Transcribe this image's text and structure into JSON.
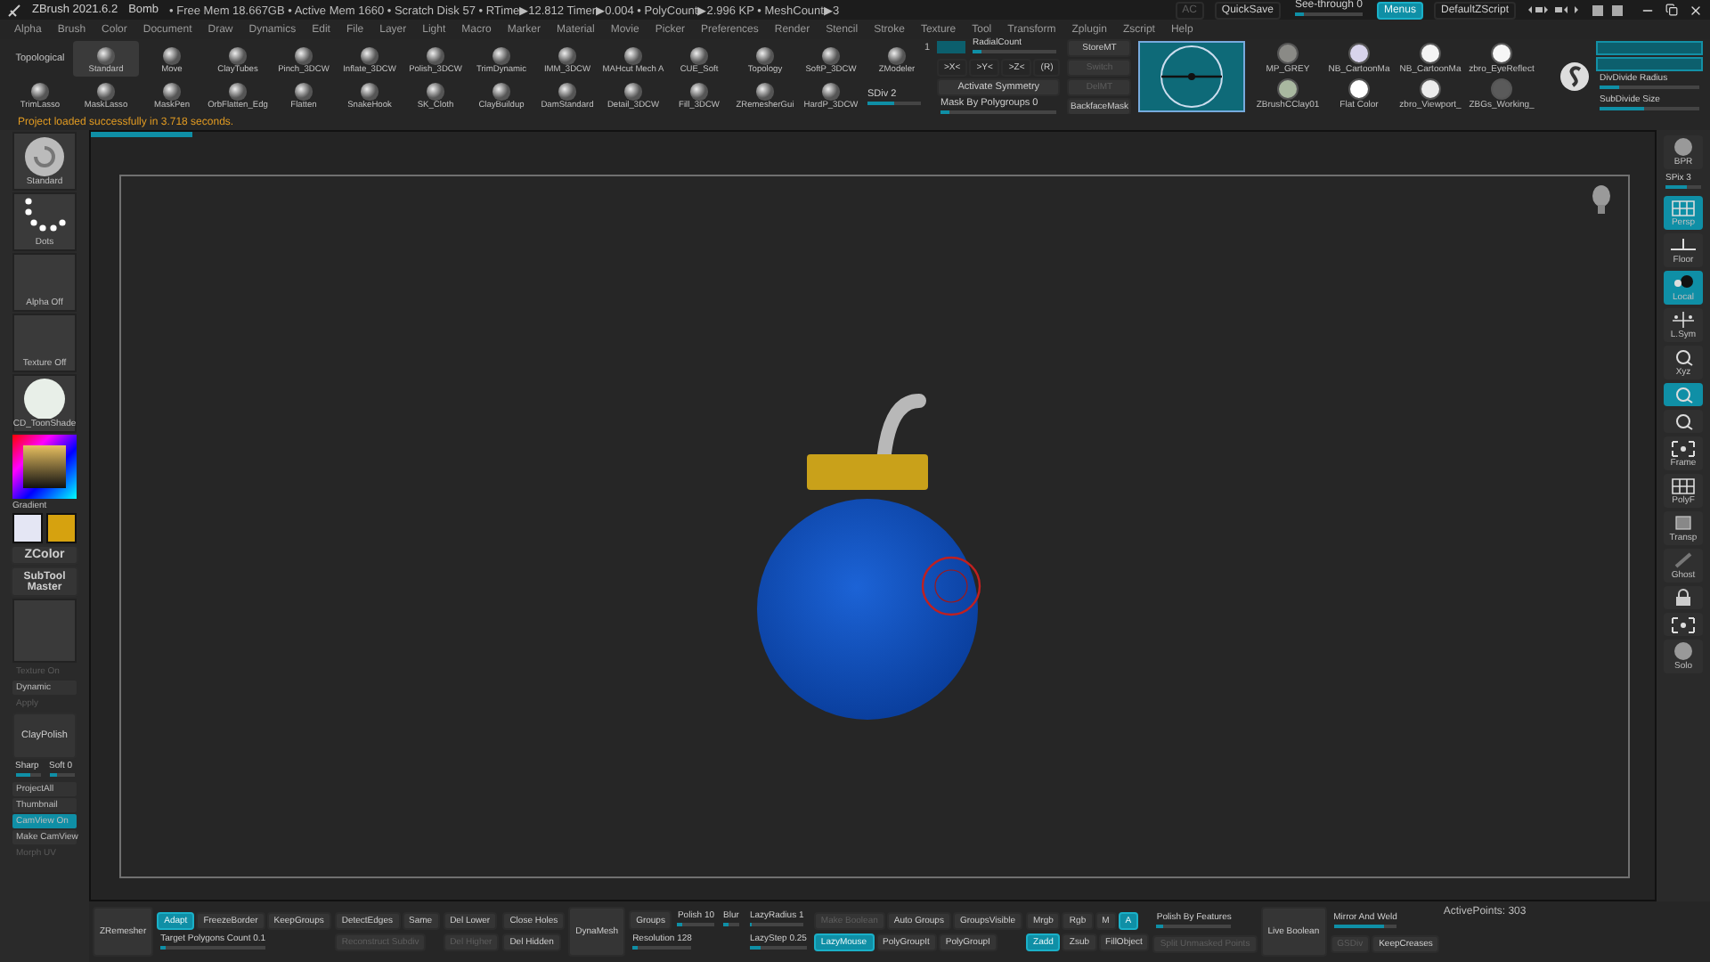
{
  "title_bar": {
    "app": "ZBrush 2021.6.2",
    "document": "Bomb",
    "status": "• Free Mem 18.667GB • Active Mem 1660 • Scratch Disk 57 • RTime▶12.812 Timer▶0.004 • PolyCount▶2.996 KP • MeshCount▶3",
    "controls": [
      {
        "kind": "button",
        "label": "AC",
        "selected": false,
        "disabled": true
      },
      {
        "kind": "button",
        "label": "QuickSave",
        "selected": false,
        "disabled": false
      },
      {
        "kind": "slider",
        "label": "See-through  0",
        "level": 0.12
      },
      {
        "kind": "button",
        "label": "Menus",
        "selected": true,
        "disabled": false
      },
      {
        "kind": "button",
        "label": "DefaultZScript",
        "selected": false,
        "disabled": false
      }
    ]
  },
  "menu": [
    "Alpha",
    "Brush",
    "Color",
    "Document",
    "Draw",
    "Dynamics",
    "Edit",
    "File",
    "Layer",
    "Light",
    "Macro",
    "Marker",
    "Material",
    "Movie",
    "Picker",
    "Preferences",
    "Render",
    "Stencil",
    "Stroke",
    "Texture",
    "Tool",
    "Transform",
    "Zplugin",
    "Zscript",
    "Help"
  ],
  "shelf": {
    "label": "Topological",
    "brush_rows": [
      [
        {
          "label": "Standard",
          "selected": true
        },
        {
          "label": "Move",
          "selected": false
        },
        {
          "label": "ClayTubes",
          "selected": false
        },
        {
          "label": "Pinch_3DCW",
          "selected": false
        },
        {
          "label": "Inflate_3DCW",
          "selected": false
        },
        {
          "label": "Polish_3DCW",
          "selected": false
        },
        {
          "label": "TrimDynamic",
          "selected": false
        },
        {
          "label": "IMM_3DCW",
          "selected": false
        },
        {
          "label": "MAHcut Mech A",
          "selected": false
        },
        {
          "label": "CUE_Soft",
          "selected": false
        },
        {
          "label": "Topology",
          "selected": false
        },
        {
          "label": "SoftP_3DCW",
          "selected": false
        },
        {
          "label": "ZModeler",
          "selected": false,
          "badge": "1"
        }
      ],
      [
        {
          "label": "TrimLasso",
          "selected": false
        },
        {
          "label": "MaskLasso",
          "selected": false
        },
        {
          "label": "MaskPen",
          "selected": false
        },
        {
          "label": "OrbFlatten_Edg",
          "selected": false
        },
        {
          "label": "Flatten",
          "selected": false
        },
        {
          "label": "SnakeHook",
          "selected": false
        },
        {
          "label": "SK_Cloth",
          "selected": false
        },
        {
          "label": "ClayBuildup",
          "selected": false
        },
        {
          "label": "DamStandard",
          "selected": false
        },
        {
          "label": "Detail_3DCW",
          "selected": false
        },
        {
          "label": "Fill_3DCW",
          "selected": false
        },
        {
          "label": "ZRemesherGui",
          "selected": false
        },
        {
          "label": "HardP_3DCW",
          "selected": false
        }
      ]
    ],
    "sdiv": {
      "label": "SDiv 2",
      "level": 0.5
    },
    "symmetry": {
      "radial_toggle": {
        "on": true
      },
      "radial": {
        "label": "RadialCount",
        "level": 0.1
      },
      "axes": [
        {
          "label": ">X<",
          "selected": false
        },
        {
          "label": ">Y<",
          "selected": false
        },
        {
          "label": ">Z<",
          "selected": false
        },
        {
          "label": "(R)",
          "selected": false
        }
      ],
      "activate": {
        "label": "Activate Symmetry",
        "selected": false
      },
      "mask": {
        "label": "Mask By Polygroups 0",
        "level": 0.08
      }
    },
    "morph": [
      {
        "label": "StoreMT",
        "disabled": false
      },
      {
        "label": "Switch",
        "disabled": true
      },
      {
        "label": "DelMT",
        "disabled": true
      },
      {
        "label": "BackfaceMask",
        "disabled": false
      }
    ],
    "materials": [
      {
        "label": "MP_GREY",
        "color": "#8a8a86"
      },
      {
        "label": "NB_CartoonMa",
        "color": "#d8d4ec"
      },
      {
        "label": "NB_CartoonMa",
        "color": "#f4f4f4"
      },
      {
        "label": "zbro_EyeReflect",
        "color": "#f6f6f6"
      },
      {
        "label": "ZBrushCClay01",
        "color": "#a9b8a0"
      },
      {
        "label": "Flat Color",
        "color": "#ffffff"
      },
      {
        "label": "zbro_Viewport_",
        "color": "#ececec"
      },
      {
        "label": "ZBGs_Working_",
        "color": "#5a5a5a"
      }
    ],
    "subdivide": [
      {
        "label": "DivDivide Radius",
        "level": 0.2
      },
      {
        "label": "SubDivide Size",
        "level": 0.45
      }
    ]
  },
  "message": "Project loaded successfully in 3.718 seconds.",
  "left_panel": [
    {
      "kind": "brush_tile",
      "label": "Standard"
    },
    {
      "kind": "dots_tile",
      "label": "Dots"
    },
    {
      "kind": "empty_tile",
      "label": "Alpha Off"
    },
    {
      "kind": "empty_tile",
      "label": "Texture Off"
    },
    {
      "kind": "material_tile",
      "label": "CD_ToonShade"
    },
    {
      "kind": "picker",
      "label": "Gradient"
    },
    {
      "kind": "swatches",
      "swatches": [
        {
          "color": "#e4e6f4"
        },
        {
          "color": "#d6a20f"
        }
      ]
    },
    {
      "kind": "zcolor",
      "label": "ZColor"
    },
    {
      "kind": "plugin",
      "label": "SubTool Master"
    },
    {
      "kind": "blank"
    },
    {
      "kind": "button",
      "label": "Texture On",
      "disabled": true,
      "selected": false
    },
    {
      "kind": "button",
      "label": "Dynamic",
      "disabled": false,
      "selected": false
    },
    {
      "kind": "button",
      "label": "Apply",
      "disabled": true,
      "selected": false
    },
    {
      "kind": "big",
      "label": "ClayPolish"
    },
    {
      "kind": "pair",
      "sliders": [
        {
          "label": "Sharp",
          "level": 0.6
        },
        {
          "label": "Soft 0",
          "level": 0.3
        }
      ]
    },
    {
      "kind": "button",
      "label": "ProjectAll",
      "disabled": false,
      "selected": false
    },
    {
      "kind": "button",
      "label": "Thumbnail",
      "disabled": false,
      "selected": false
    },
    {
      "kind": "button",
      "label": "CamView On",
      "disabled": false,
      "selected": true
    },
    {
      "kind": "button",
      "label": "Make CamView",
      "disabled": false,
      "selected": false
    },
    {
      "kind": "button",
      "label": "Morph UV",
      "disabled": true,
      "selected": false
    }
  ],
  "canvas": {
    "load_progress": {
      "level": 0.065
    }
  },
  "right_shelf": [
    {
      "kind": "tool",
      "label": "BPR",
      "selected": false
    },
    {
      "kind": "slider",
      "label": "SPix 3",
      "level": 0.6
    },
    {
      "kind": "tool",
      "label": "Persp",
      "selected": true
    },
    {
      "kind": "tool",
      "label": "Floor",
      "selected": false
    },
    {
      "kind": "tool",
      "label": "Local",
      "selected": true
    },
    {
      "kind": "tool",
      "label": "L.Sym",
      "selected": false
    },
    {
      "kind": "tool",
      "label": "Xyz",
      "selected": false
    },
    {
      "kind": "tool",
      "selected": true
    },
    {
      "kind": "tool",
      "selected": false
    },
    {
      "kind": "tool",
      "label": "Frame",
      "selected": false
    },
    {
      "kind": "tool",
      "label": "PolyF",
      "selected": false
    },
    {
      "kind": "tool",
      "label": "Transp",
      "selected": false
    },
    {
      "kind": "tool",
      "label": "Ghost",
      "selected": false
    },
    {
      "kind": "tool",
      "selected": false
    },
    {
      "kind": "tool",
      "selected": false
    },
    {
      "kind": "tool",
      "label": "Solo",
      "selected": false
    }
  ],
  "bottom_bar": [
    {
      "tall": {
        "kind": "button",
        "label": "ZRemesher",
        "selected": false,
        "disabled": false
      }
    },
    {
      "top": [
        {
          "kind": "button",
          "label": "Adapt",
          "selected": true,
          "disabled": false
        },
        {
          "kind": "button",
          "label": "FreezeBorder",
          "selected": false,
          "disabled": false
        },
        {
          "kind": "button",
          "label": "KeepGroups",
          "selected": false,
          "disabled": false
        }
      ],
      "bottom": [
        {
          "kind": "slider",
          "label": "Target Polygons Count 0.1",
          "level": 0.05
        }
      ]
    },
    {
      "top": [
        {
          "kind": "button",
          "label": "DetectEdges",
          "selected": false,
          "disabled": false
        },
        {
          "kind": "button",
          "label": "Same",
          "selected": false,
          "disabled": false
        }
      ],
      "bottom": [
        {
          "kind": "button",
          "label": "Reconstruct Subdiv",
          "selected": false,
          "disabled": true
        }
      ]
    },
    {
      "top": [
        {
          "kind": "button",
          "label": "Del Lower",
          "selected": false,
          "disabled": false
        }
      ],
      "bottom": [
        {
          "kind": "button",
          "label": "Del Higher",
          "selected": false,
          "disabled": true
        }
      ]
    },
    {
      "top": [
        {
          "kind": "button",
          "label": "Close Holes",
          "selected": false,
          "disabled": false
        }
      ],
      "bottom": [
        {
          "kind": "button",
          "label": "Del Hidden",
          "selected": false,
          "disabled": false
        }
      ]
    },
    {
      "tall": {
        "kind": "button",
        "label": "DynaMesh",
        "selected": false,
        "disabled": false
      }
    },
    {
      "top": [
        {
          "kind": "button",
          "label": "Groups",
          "selected": false,
          "disabled": false
        },
        {
          "kind": "slider",
          "label": "Polish 10",
          "level": 0.1
        },
        {
          "kind": "slider",
          "label": "Blur",
          "level": 0.3
        }
      ],
      "bottom": [
        {
          "kind": "slider",
          "label": "Resolution 128",
          "level": 0.1
        }
      ]
    },
    {
      "top": [
        {
          "kind": "slider",
          "label": "LazyRadius 1",
          "level": 0.05
        }
      ],
      "bottom": [
        {
          "kind": "slider",
          "label": "LazyStep 0.25",
          "level": 0.2
        }
      ]
    },
    {
      "top": [
        {
          "kind": "button",
          "label": "Make Boolean",
          "selected": false,
          "disabled": true
        },
        {
          "kind": "button",
          "label": "Auto Groups",
          "selected": false,
          "disabled": false
        },
        {
          "kind": "button",
          "label": "GroupsVisible",
          "selected": false,
          "disabled": false
        }
      ],
      "bottom": [
        {
          "kind": "button",
          "label": "LazyMouse",
          "selected": true,
          "disabled": false
        },
        {
          "kind": "button",
          "label": "PolyGroupIt",
          "selected": false,
          "disabled": false
        },
        {
          "kind": "button",
          "label": "PolyGroupI",
          "selected": false,
          "disabled": false
        }
      ]
    },
    {
      "top": [
        {
          "kind": "button",
          "label": "Mrgb",
          "selected": false,
          "disabled": false
        },
        {
          "kind": "button",
          "label": "Rgb",
          "selected": false,
          "disabled": false
        },
        {
          "kind": "button",
          "label": "M",
          "selected": false,
          "disabled": false
        },
        {
          "kind": "button",
          "label": "A",
          "selected": true,
          "disabled": false
        }
      ],
      "bottom": [
        {
          "kind": "button",
          "label": "Zadd",
          "selected": true,
          "disabled": false
        },
        {
          "kind": "button",
          "label": "Zsub",
          "selected": false,
          "disabled": false
        },
        {
          "kind": "button",
          "label": "FillObject",
          "selected": false,
          "disabled": false
        }
      ]
    },
    {
      "top": [
        {
          "kind": "slider",
          "label": "Polish By Features",
          "level": 0.08
        }
      ],
      "bottom": [
        {
          "kind": "button",
          "label": "Split Unmasked Points",
          "selected": false,
          "disabled": true
        }
      ]
    },
    {
      "tall": {
        "kind": "button",
        "label": "Live Boolean",
        "selected": false,
        "disabled": false
      }
    },
    {
      "top": [
        {
          "kind": "slider",
          "label": "Mirror And Weld",
          "level": 0.8
        }
      ],
      "bottom": [
        {
          "kind": "button",
          "label": "GSDiv",
          "selected": false,
          "disabled": true
        },
        {
          "kind": "button",
          "label": "KeepCreases",
          "selected": false,
          "disabled": false
        }
      ]
    },
    {
      "tall": {
        "kind": "text",
        "label": "ActivePoints: 303"
      }
    }
  ]
}
